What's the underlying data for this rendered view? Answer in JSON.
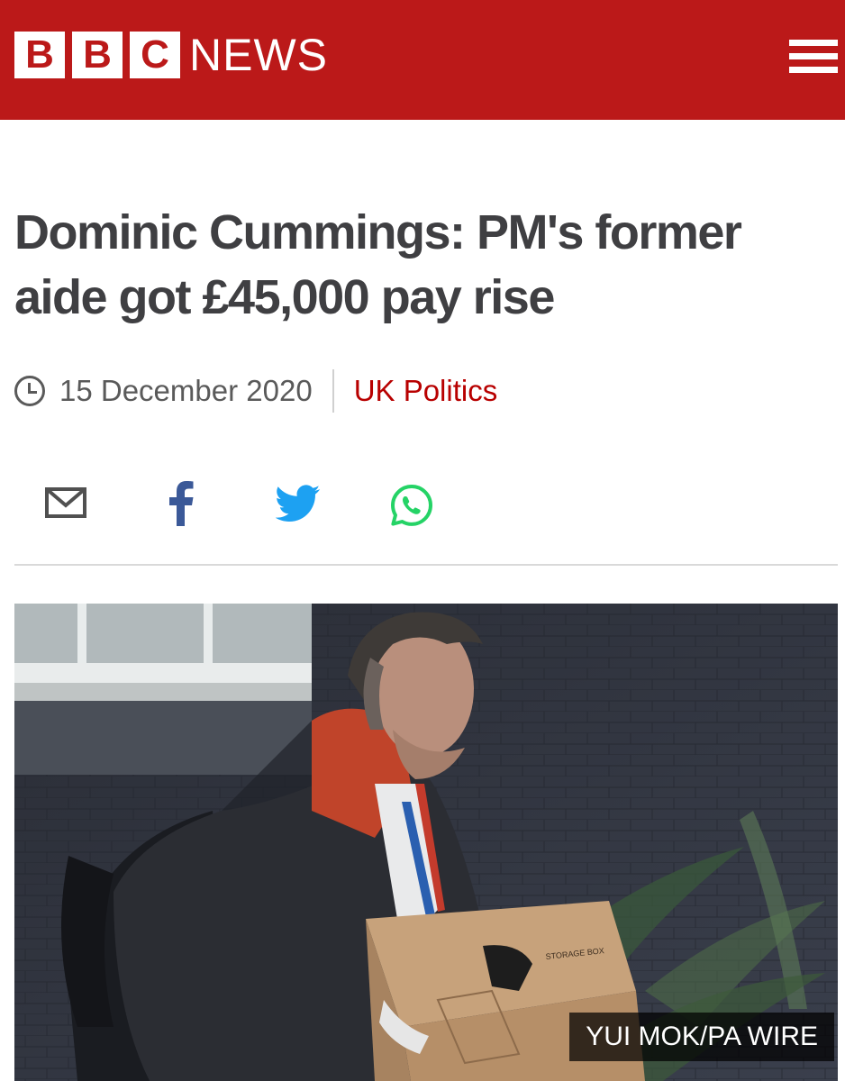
{
  "header": {
    "brand_letters": [
      "B",
      "B",
      "C"
    ],
    "news_word": "NEWS",
    "menu_icon": "hamburger-menu-icon"
  },
  "article": {
    "headline": "Dominic Cummings: PM's former aide got £45,000 pay rise",
    "date_icon": "clock-icon",
    "date": "15 December 2020",
    "category": "UK Politics"
  },
  "share": {
    "icons": [
      "email-icon",
      "facebook-icon",
      "twitter-icon",
      "whatsapp-icon"
    ]
  },
  "image": {
    "copyright": "YUI MOK/PA WIRE"
  },
  "colors": {
    "brand_red": "#bb1919",
    "category_red": "#b80000",
    "facebook_blue": "#3b5998",
    "twitter_blue": "#1da1f2",
    "whatsapp_green": "#25d366"
  }
}
